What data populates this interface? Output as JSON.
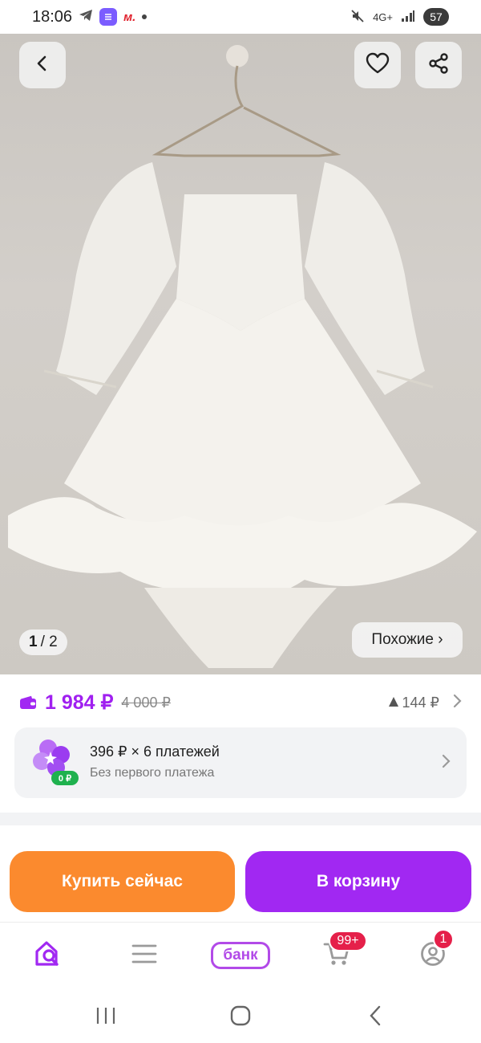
{
  "status_bar": {
    "time": "18:06",
    "network": "4G+",
    "battery": "57"
  },
  "gallery": {
    "counter_current": "1",
    "counter_total": "/ 2",
    "similar_label": "Похожие ›"
  },
  "price": {
    "current": "1 984 ₽",
    "old": "4 000 ₽",
    "bonus": "144 ₽"
  },
  "installment": {
    "title": "396 ₽ × 6 платежей",
    "subtitle": "Без первого платежа",
    "icon_badge": "0 ₽"
  },
  "actions": {
    "buy_now": "Купить сейчас",
    "to_cart": "В корзину"
  },
  "tabbar": {
    "bank_label": "банк",
    "cart_badge": "99+",
    "profile_badge": "1"
  },
  "colors": {
    "accent_purple": "#a128f2",
    "accent_orange": "#fb8a2e",
    "badge_red": "#e5204a"
  },
  "icons": [
    "back-icon",
    "heart-icon",
    "share-icon",
    "wallet-icon",
    "chevron-right-icon",
    "home-search-icon",
    "menu-icon",
    "cart-icon",
    "profile-icon"
  ]
}
